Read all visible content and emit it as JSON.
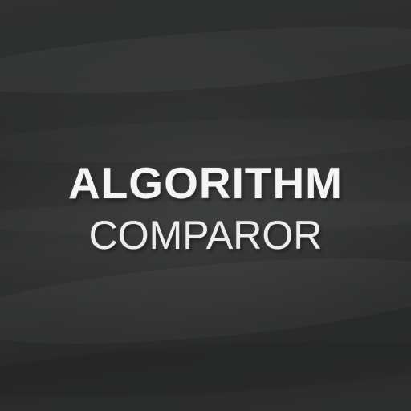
{
  "title": {
    "line1": "ALGORITHM",
    "line2": "COMPAROR"
  },
  "colors": {
    "background": "#2b2c2c",
    "text": "#f4f4f2"
  }
}
